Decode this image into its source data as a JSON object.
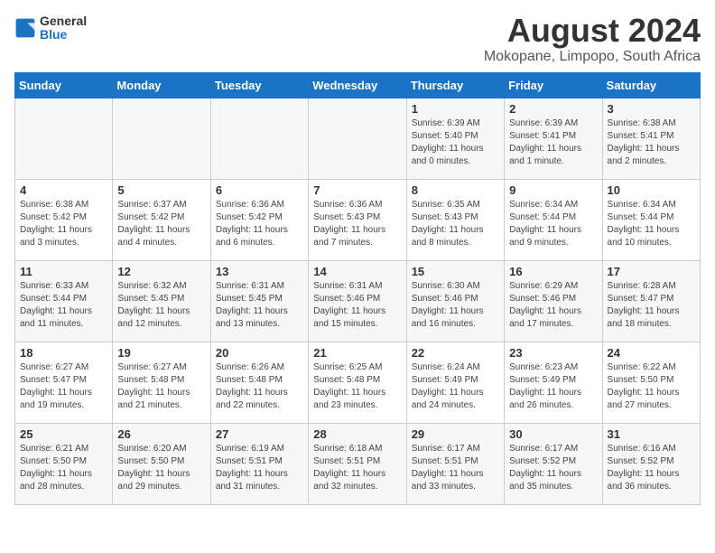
{
  "logo": {
    "line1": "General",
    "line2": "Blue"
  },
  "title": "August 2024",
  "location": "Mokopane, Limpopo, South Africa",
  "weekdays": [
    "Sunday",
    "Monday",
    "Tuesday",
    "Wednesday",
    "Thursday",
    "Friday",
    "Saturday"
  ],
  "weeks": [
    [
      {
        "day": "",
        "info": ""
      },
      {
        "day": "",
        "info": ""
      },
      {
        "day": "",
        "info": ""
      },
      {
        "day": "",
        "info": ""
      },
      {
        "day": "1",
        "info": "Sunrise: 6:39 AM\nSunset: 5:40 PM\nDaylight: 11 hours and 0 minutes."
      },
      {
        "day": "2",
        "info": "Sunrise: 6:39 AM\nSunset: 5:41 PM\nDaylight: 11 hours and 1 minute."
      },
      {
        "day": "3",
        "info": "Sunrise: 6:38 AM\nSunset: 5:41 PM\nDaylight: 11 hours and 2 minutes."
      }
    ],
    [
      {
        "day": "4",
        "info": "Sunrise: 6:38 AM\nSunset: 5:42 PM\nDaylight: 11 hours and 3 minutes."
      },
      {
        "day": "5",
        "info": "Sunrise: 6:37 AM\nSunset: 5:42 PM\nDaylight: 11 hours and 4 minutes."
      },
      {
        "day": "6",
        "info": "Sunrise: 6:36 AM\nSunset: 5:42 PM\nDaylight: 11 hours and 6 minutes."
      },
      {
        "day": "7",
        "info": "Sunrise: 6:36 AM\nSunset: 5:43 PM\nDaylight: 11 hours and 7 minutes."
      },
      {
        "day": "8",
        "info": "Sunrise: 6:35 AM\nSunset: 5:43 PM\nDaylight: 11 hours and 8 minutes."
      },
      {
        "day": "9",
        "info": "Sunrise: 6:34 AM\nSunset: 5:44 PM\nDaylight: 11 hours and 9 minutes."
      },
      {
        "day": "10",
        "info": "Sunrise: 6:34 AM\nSunset: 5:44 PM\nDaylight: 11 hours and 10 minutes."
      }
    ],
    [
      {
        "day": "11",
        "info": "Sunrise: 6:33 AM\nSunset: 5:44 PM\nDaylight: 11 hours and 11 minutes."
      },
      {
        "day": "12",
        "info": "Sunrise: 6:32 AM\nSunset: 5:45 PM\nDaylight: 11 hours and 12 minutes."
      },
      {
        "day": "13",
        "info": "Sunrise: 6:31 AM\nSunset: 5:45 PM\nDaylight: 11 hours and 13 minutes."
      },
      {
        "day": "14",
        "info": "Sunrise: 6:31 AM\nSunset: 5:46 PM\nDaylight: 11 hours and 15 minutes."
      },
      {
        "day": "15",
        "info": "Sunrise: 6:30 AM\nSunset: 5:46 PM\nDaylight: 11 hours and 16 minutes."
      },
      {
        "day": "16",
        "info": "Sunrise: 6:29 AM\nSunset: 5:46 PM\nDaylight: 11 hours and 17 minutes."
      },
      {
        "day": "17",
        "info": "Sunrise: 6:28 AM\nSunset: 5:47 PM\nDaylight: 11 hours and 18 minutes."
      }
    ],
    [
      {
        "day": "18",
        "info": "Sunrise: 6:27 AM\nSunset: 5:47 PM\nDaylight: 11 hours and 19 minutes."
      },
      {
        "day": "19",
        "info": "Sunrise: 6:27 AM\nSunset: 5:48 PM\nDaylight: 11 hours and 21 minutes."
      },
      {
        "day": "20",
        "info": "Sunrise: 6:26 AM\nSunset: 5:48 PM\nDaylight: 11 hours and 22 minutes."
      },
      {
        "day": "21",
        "info": "Sunrise: 6:25 AM\nSunset: 5:48 PM\nDaylight: 11 hours and 23 minutes."
      },
      {
        "day": "22",
        "info": "Sunrise: 6:24 AM\nSunset: 5:49 PM\nDaylight: 11 hours and 24 minutes."
      },
      {
        "day": "23",
        "info": "Sunrise: 6:23 AM\nSunset: 5:49 PM\nDaylight: 11 hours and 26 minutes."
      },
      {
        "day": "24",
        "info": "Sunrise: 6:22 AM\nSunset: 5:50 PM\nDaylight: 11 hours and 27 minutes."
      }
    ],
    [
      {
        "day": "25",
        "info": "Sunrise: 6:21 AM\nSunset: 5:50 PM\nDaylight: 11 hours and 28 minutes."
      },
      {
        "day": "26",
        "info": "Sunrise: 6:20 AM\nSunset: 5:50 PM\nDaylight: 11 hours and 29 minutes."
      },
      {
        "day": "27",
        "info": "Sunrise: 6:19 AM\nSunset: 5:51 PM\nDaylight: 11 hours and 31 minutes."
      },
      {
        "day": "28",
        "info": "Sunrise: 6:18 AM\nSunset: 5:51 PM\nDaylight: 11 hours and 32 minutes."
      },
      {
        "day": "29",
        "info": "Sunrise: 6:17 AM\nSunset: 5:51 PM\nDaylight: 11 hours and 33 minutes."
      },
      {
        "day": "30",
        "info": "Sunrise: 6:17 AM\nSunset: 5:52 PM\nDaylight: 11 hours and 35 minutes."
      },
      {
        "day": "31",
        "info": "Sunrise: 6:16 AM\nSunset: 5:52 PM\nDaylight: 11 hours and 36 minutes."
      }
    ]
  ]
}
